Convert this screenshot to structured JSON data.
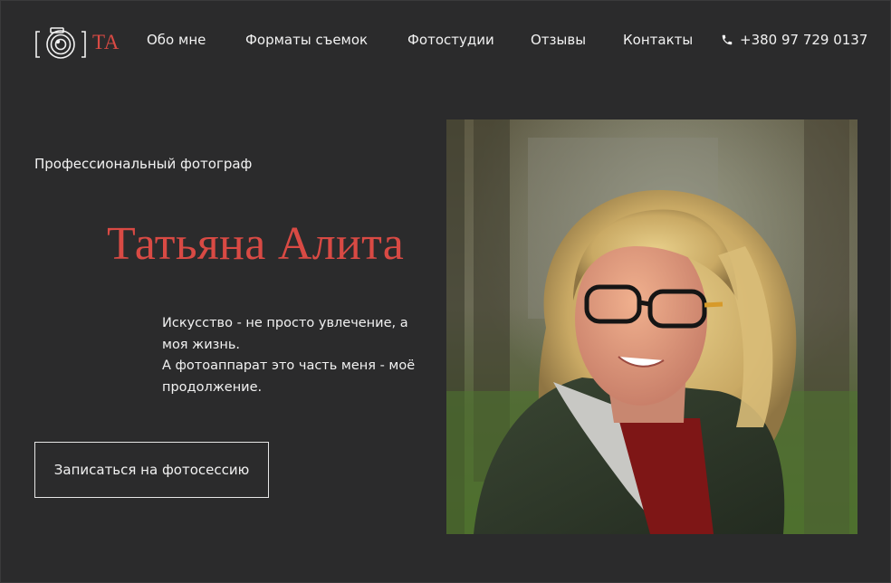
{
  "header": {
    "logo": {
      "text": "TA",
      "icon": "camera-icon"
    },
    "nav": [
      {
        "label": "Обо мне"
      },
      {
        "label": "Форматы съемок"
      },
      {
        "label": "Фотостудии"
      },
      {
        "label": "Отзывы"
      },
      {
        "label": "Контакты"
      }
    ],
    "phone": {
      "icon": "phone-icon",
      "number": "+380 97 729 0137"
    }
  },
  "hero": {
    "subtitle": "Профессиональный фотограф",
    "name": "Татьяна Алита",
    "tagline_lines": [
      "Искусство - не просто увлечение, а моя жизнь.",
      "А фотоаппарат это часть меня - моё продолжение."
    ],
    "cta_label": "Записаться на фотосессию"
  },
  "colors": {
    "background": "#2b2b2c",
    "accent": "#d94a44",
    "text": "#f2f2f2"
  }
}
